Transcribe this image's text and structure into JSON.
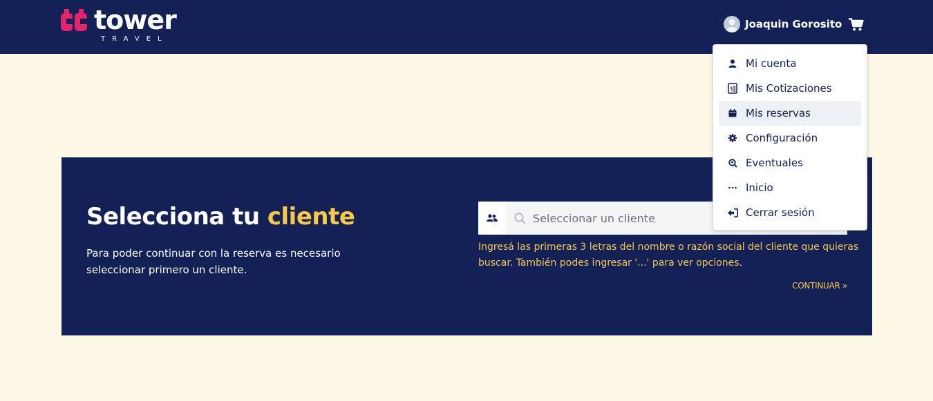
{
  "brand": {
    "name": "tower",
    "subtitle": "TRAVEL",
    "accent_color": "#e5246f",
    "navy_color": "#132156",
    "yellow_color": "#f7c84a"
  },
  "header": {
    "user_name": "Joaquin Gorosito",
    "avatar_icon": "user-avatar-icon",
    "cart_icon": "shopping-cart-icon"
  },
  "user_menu": {
    "items": [
      {
        "label": "Mi cuenta",
        "icon": "user-icon"
      },
      {
        "label": "Mis Cotizaciones",
        "icon": "invoice-dollar-icon"
      },
      {
        "label": "Mis reservas",
        "icon": "calendar-icon",
        "active": true
      },
      {
        "label": "Configuración",
        "icon": "gear-icon"
      },
      {
        "label": "Eventuales",
        "icon": "search-location-icon"
      },
      {
        "label": "Inicio",
        "icon": "ellipsis-icon"
      },
      {
        "label": "Cerrar sesión",
        "icon": "sign-out-icon"
      }
    ]
  },
  "client_panel": {
    "title_prefix": "Selecciona tu",
    "title_accent": "cliente",
    "description": "Para poder continuar con la reserva es necesario seleccionar primero un cliente.",
    "search_placeholder": "Seleccionar un cliente",
    "search_value": "",
    "hint": "Ingresá las primeras 3 letras del nombre o razón social del cliente que quieras buscar. También podes ingresar '...' para ver opciones.",
    "continue_label": "CONTINUAR »"
  }
}
